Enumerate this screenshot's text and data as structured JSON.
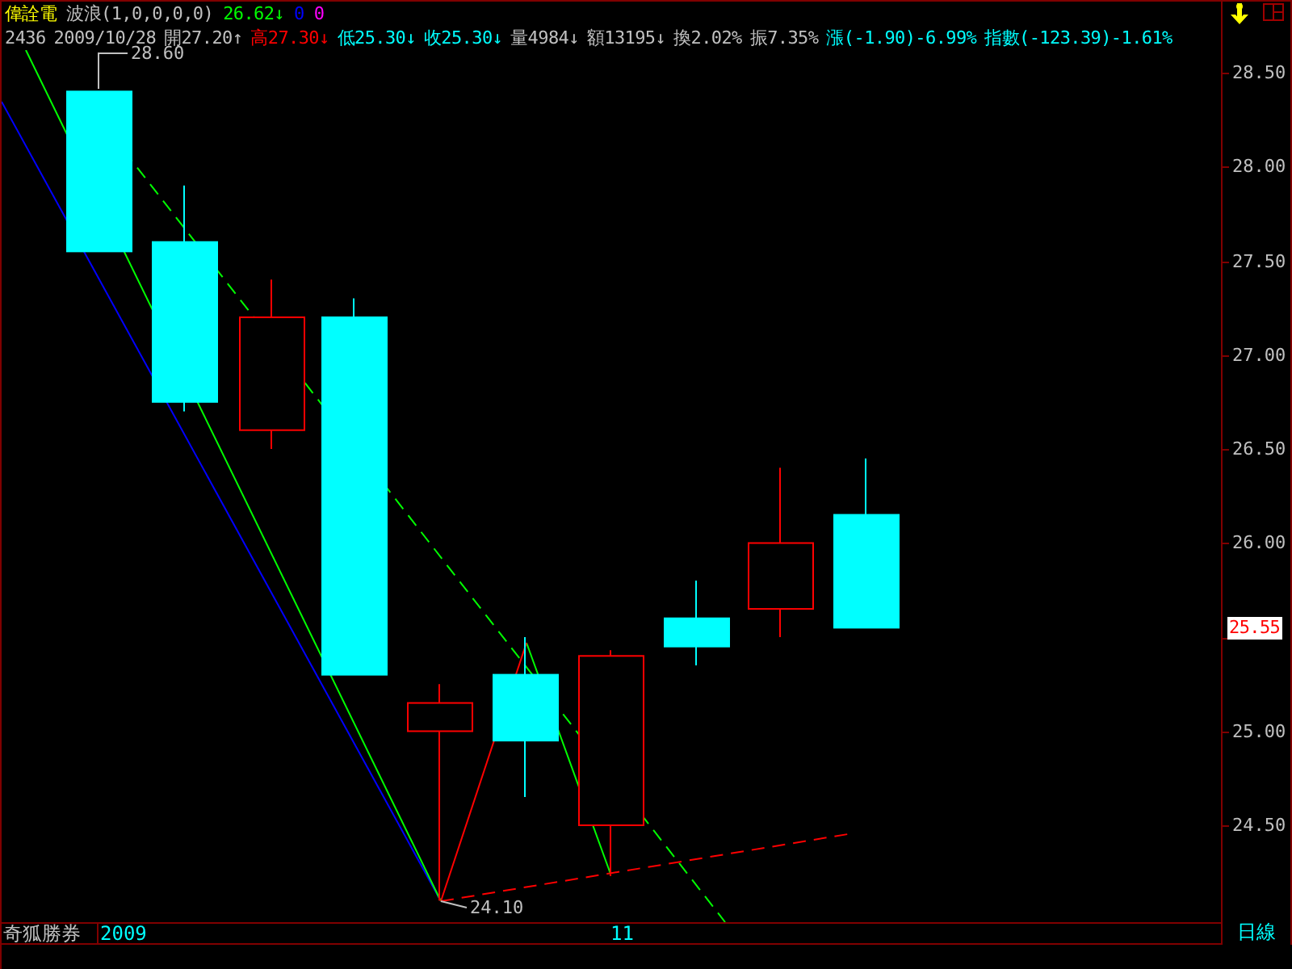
{
  "header": {
    "stock_name": "偉詮電",
    "indicator": "波浪(1,0,0,0,0)",
    "indicator_value": "26.62↓",
    "values": [
      {
        "text": "0",
        "color": "#0000ff"
      },
      {
        "text": "0",
        "color": "#ff00ff"
      }
    ]
  },
  "quote": [
    {
      "text": "2436",
      "color": "#c0c0c0"
    },
    {
      "text": "2009/10/28",
      "color": "#c0c0c0"
    },
    {
      "text": "開27.20↑",
      "color": "#c0c0c0"
    },
    {
      "text": "高27.30↓",
      "color": "#ff0000"
    },
    {
      "text": "低25.30↓",
      "color": "#00ffff"
    },
    {
      "text": "收25.30↓",
      "color": "#00ffff"
    },
    {
      "text": "量4984↓",
      "color": "#c0c0c0"
    },
    {
      "text": "額13195↓",
      "color": "#c0c0c0"
    },
    {
      "text": "換2.02%",
      "color": "#c0c0c0"
    },
    {
      "text": "振7.35%",
      "color": "#c0c0c0"
    },
    {
      "text": "漲(-1.90)-6.99%",
      "color": "#00ffff"
    },
    {
      "text": "指數(-123.39)-1.61%",
      "color": "#00ffff"
    }
  ],
  "chart": {
    "y_axis_labels": [
      "28.50",
      "28.00",
      "27.50",
      "27.00",
      "26.50",
      "26.00",
      "25.00",
      "24.50"
    ],
    "high_label": "28.60",
    "low_label": "24.10",
    "last_price": "25.55"
  },
  "footer": {
    "broker": "奇狐勝券",
    "x_labels": [
      "2009",
      "11"
    ],
    "period": "日線"
  }
}
